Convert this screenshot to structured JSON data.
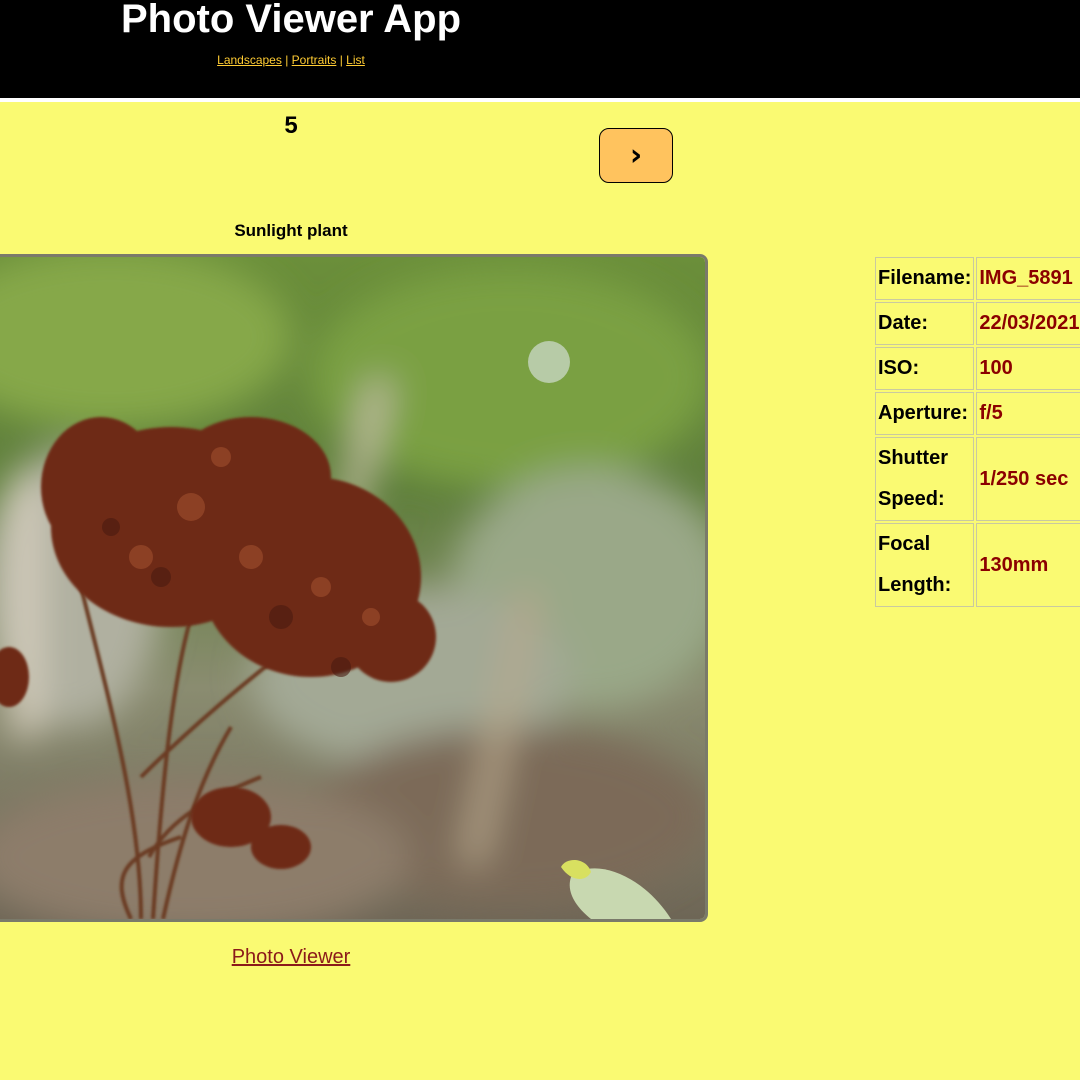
{
  "header": {
    "title": "Photo Viewer App",
    "nav": [
      {
        "label": "Landscapes"
      },
      {
        "label": "Portraits"
      },
      {
        "label": "List"
      }
    ],
    "separator": "|"
  },
  "viewer": {
    "counter": "5",
    "next_label": "›",
    "caption": "Sunlight plant"
  },
  "details": {
    "rows": [
      {
        "key": "Filename:",
        "value": "IMG_5891"
      },
      {
        "key": "Date:",
        "value": "22/03/2021"
      },
      {
        "key": "ISO:",
        "value": "100"
      },
      {
        "key": "Aperture:",
        "value": "f/5"
      },
      {
        "key": "Shutter Speed:",
        "value": "1/250 sec"
      },
      {
        "key": "Focal Length:",
        "value": "130mm"
      }
    ]
  },
  "footer": {
    "link_label": "Photo Viewer"
  },
  "colors": {
    "page_background": "#fafa72",
    "header_background": "#000000",
    "nav_link": "#ffcc33",
    "button": "#ffc35e",
    "detail_value": "#8b0000",
    "footer_link": "#8b1a1a"
  }
}
